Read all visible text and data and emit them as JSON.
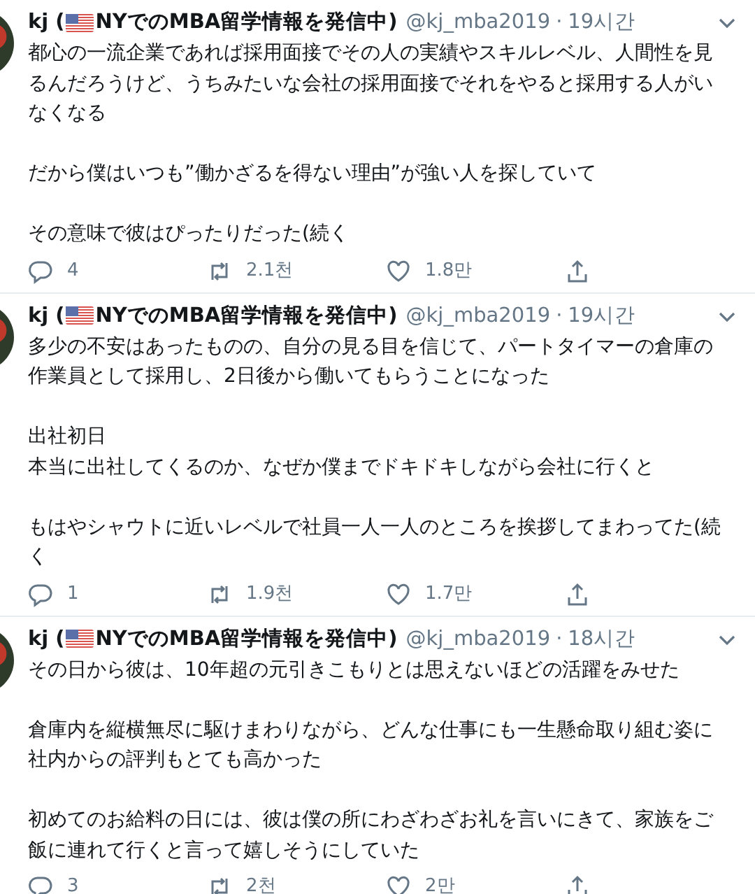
{
  "tweets": [
    {
      "name_start": "kj (",
      "name_end": "NYでのMBA留学情報を発信中)",
      "handle": "@kj_mba2019",
      "separator": "·",
      "time": "19시간",
      "paragraphs": [
        [
          "都心の一流企業であれば採用面接でその人の実績やスキルレベル、人間性を見るんだろうけど、うちみたいな会社の採用面接でそれをやると採用する人がいなくなる"
        ],
        [
          "だから僕はいつも”働かざるを得ない理由”が強い人を探していて"
        ],
        [
          "その意味で彼はぴったりだった(続く"
        ]
      ],
      "replies": "4",
      "retweets": "2.1천",
      "likes": "1.8만"
    },
    {
      "name_start": "kj (",
      "name_end": "NYでのMBA留学情報を発信中)",
      "handle": "@kj_mba2019",
      "separator": "·",
      "time": "19시간",
      "paragraphs": [
        [
          "多少の不安はあったものの、自分の見る目を信じて、パートタイマーの倉庫の作業員として採用し、2日後から働いてもらうことになった"
        ],
        [
          "出社初日",
          "本当に出社してくるのか、なぜか僕までドキドキしながら会社に行くと"
        ],
        [
          "もはやシャウトに近いレベルで社員一人一人のところを挨拶してまわってた(続く"
        ]
      ],
      "replies": "1",
      "retweets": "1.9천",
      "likes": "1.7만"
    },
    {
      "name_start": "kj (",
      "name_end": "NYでのMBA留学情報を発信中)",
      "handle": "@kj_mba2019",
      "separator": "·",
      "time": "18시간",
      "paragraphs": [
        [
          "その日から彼は、10年超の元引きこもりとは思えないほどの活躍をみせた"
        ],
        [
          "倉庫内を縦横無尽に駆けまわりながら、どんな仕事にも一生懸命取り組む姿に社内からの評判もとても高かった"
        ],
        [
          "初めてのお給料の日には、彼は僕の所にわざわざお礼を言いにきて、家族をご飯に連れて行くと言って嬉しそうにしていた"
        ]
      ],
      "replies": "3",
      "retweets": "2천",
      "likes": "2만"
    }
  ]
}
